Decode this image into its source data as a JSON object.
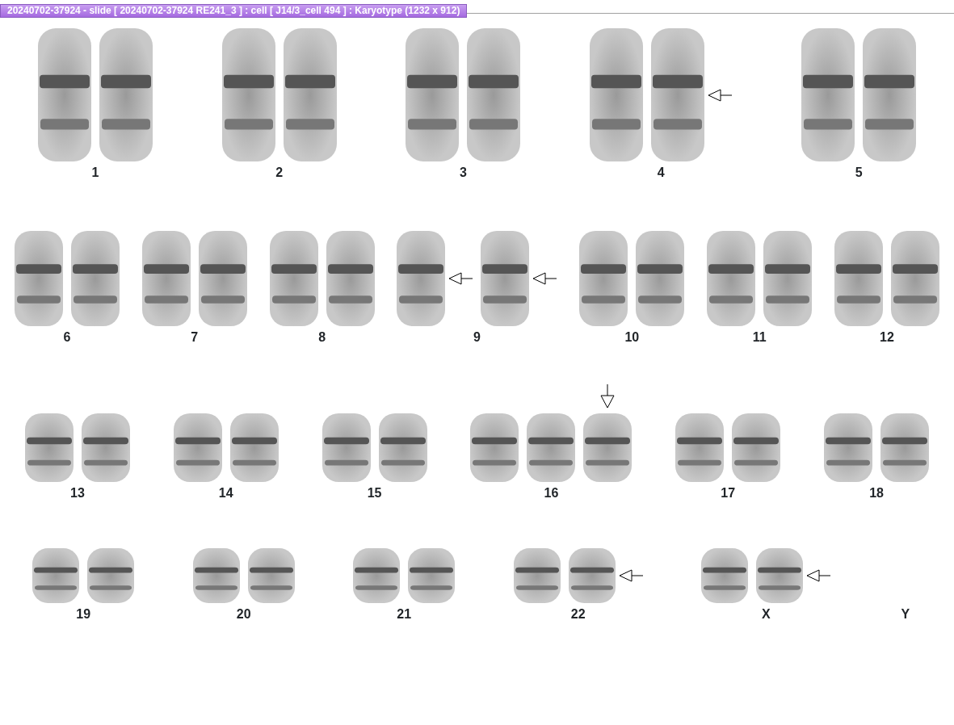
{
  "window": {
    "title": "20240702-37924 - slide [ 20240702-37924 RE241_3 ] : cell [ J14/3_cell 494 ] : Karyotype  (1232 x 912)"
  },
  "rows": [
    {
      "groups": [
        {
          "label": "1",
          "chromosomes": [
            {
              "kind": "plain"
            },
            {
              "kind": "plain"
            }
          ]
        },
        {
          "label": "2",
          "chromosomes": [
            {
              "kind": "plain"
            },
            {
              "kind": "plain"
            }
          ]
        },
        {
          "label": "3",
          "chromosomes": [
            {
              "kind": "plain"
            },
            {
              "kind": "plain"
            }
          ]
        },
        {
          "label": "4",
          "chromosomes": [
            {
              "kind": "plain"
            },
            {
              "kind": "arrowed"
            }
          ]
        },
        {
          "label": "5",
          "chromosomes": [
            {
              "kind": "plain"
            },
            {
              "kind": "plain"
            }
          ]
        }
      ]
    },
    {
      "groups": [
        {
          "label": "6",
          "chromosomes": [
            {
              "kind": "plain"
            },
            {
              "kind": "plain"
            }
          ]
        },
        {
          "label": "7",
          "chromosomes": [
            {
              "kind": "plain"
            },
            {
              "kind": "plain"
            }
          ]
        },
        {
          "label": "8",
          "chromosomes": [
            {
              "kind": "plain"
            },
            {
              "kind": "plain"
            }
          ]
        },
        {
          "label": "9",
          "chromosomes": [
            {
              "kind": "arrowed"
            },
            {
              "kind": "arrowed"
            }
          ]
        },
        {
          "label": "10",
          "chromosomes": [
            {
              "kind": "plain"
            },
            {
              "kind": "plain"
            }
          ]
        },
        {
          "label": "11",
          "chromosomes": [
            {
              "kind": "plain"
            },
            {
              "kind": "plain"
            }
          ]
        },
        {
          "label": "12",
          "chromosomes": [
            {
              "kind": "plain"
            },
            {
              "kind": "plain"
            }
          ]
        }
      ]
    },
    {
      "groups": [
        {
          "label": "13",
          "chromosomes": [
            {
              "kind": "plain"
            },
            {
              "kind": "plain"
            }
          ]
        },
        {
          "label": "14",
          "chromosomes": [
            {
              "kind": "plain"
            },
            {
              "kind": "plain"
            }
          ]
        },
        {
          "label": "15",
          "chromosomes": [
            {
              "kind": "plain"
            },
            {
              "kind": "plain"
            }
          ]
        },
        {
          "label": "16",
          "chromosomes": [
            {
              "kind": "plain"
            },
            {
              "kind": "plain"
            },
            {
              "kind": "topmarked"
            }
          ]
        },
        {
          "label": "17",
          "chromosomes": [
            {
              "kind": "plain"
            },
            {
              "kind": "plain"
            }
          ]
        },
        {
          "label": "18",
          "chromosomes": [
            {
              "kind": "plain"
            },
            {
              "kind": "plain"
            }
          ]
        }
      ]
    },
    {
      "groups": [
        {
          "label": "19",
          "chromosomes": [
            {
              "kind": "plain"
            },
            {
              "kind": "plain"
            }
          ]
        },
        {
          "label": "20",
          "chromosomes": [
            {
              "kind": "plain"
            },
            {
              "kind": "plain"
            }
          ]
        },
        {
          "label": "21",
          "chromosomes": [
            {
              "kind": "plain"
            },
            {
              "kind": "plain"
            }
          ]
        },
        {
          "label": "22",
          "chromosomes": [
            {
              "kind": "plain"
            },
            {
              "kind": "arrowed"
            }
          ]
        },
        {
          "label": "X",
          "chromosomes": [
            {
              "kind": "plain"
            },
            {
              "kind": "arrowed"
            }
          ]
        },
        {
          "label": "Y"
        }
      ]
    }
  ]
}
